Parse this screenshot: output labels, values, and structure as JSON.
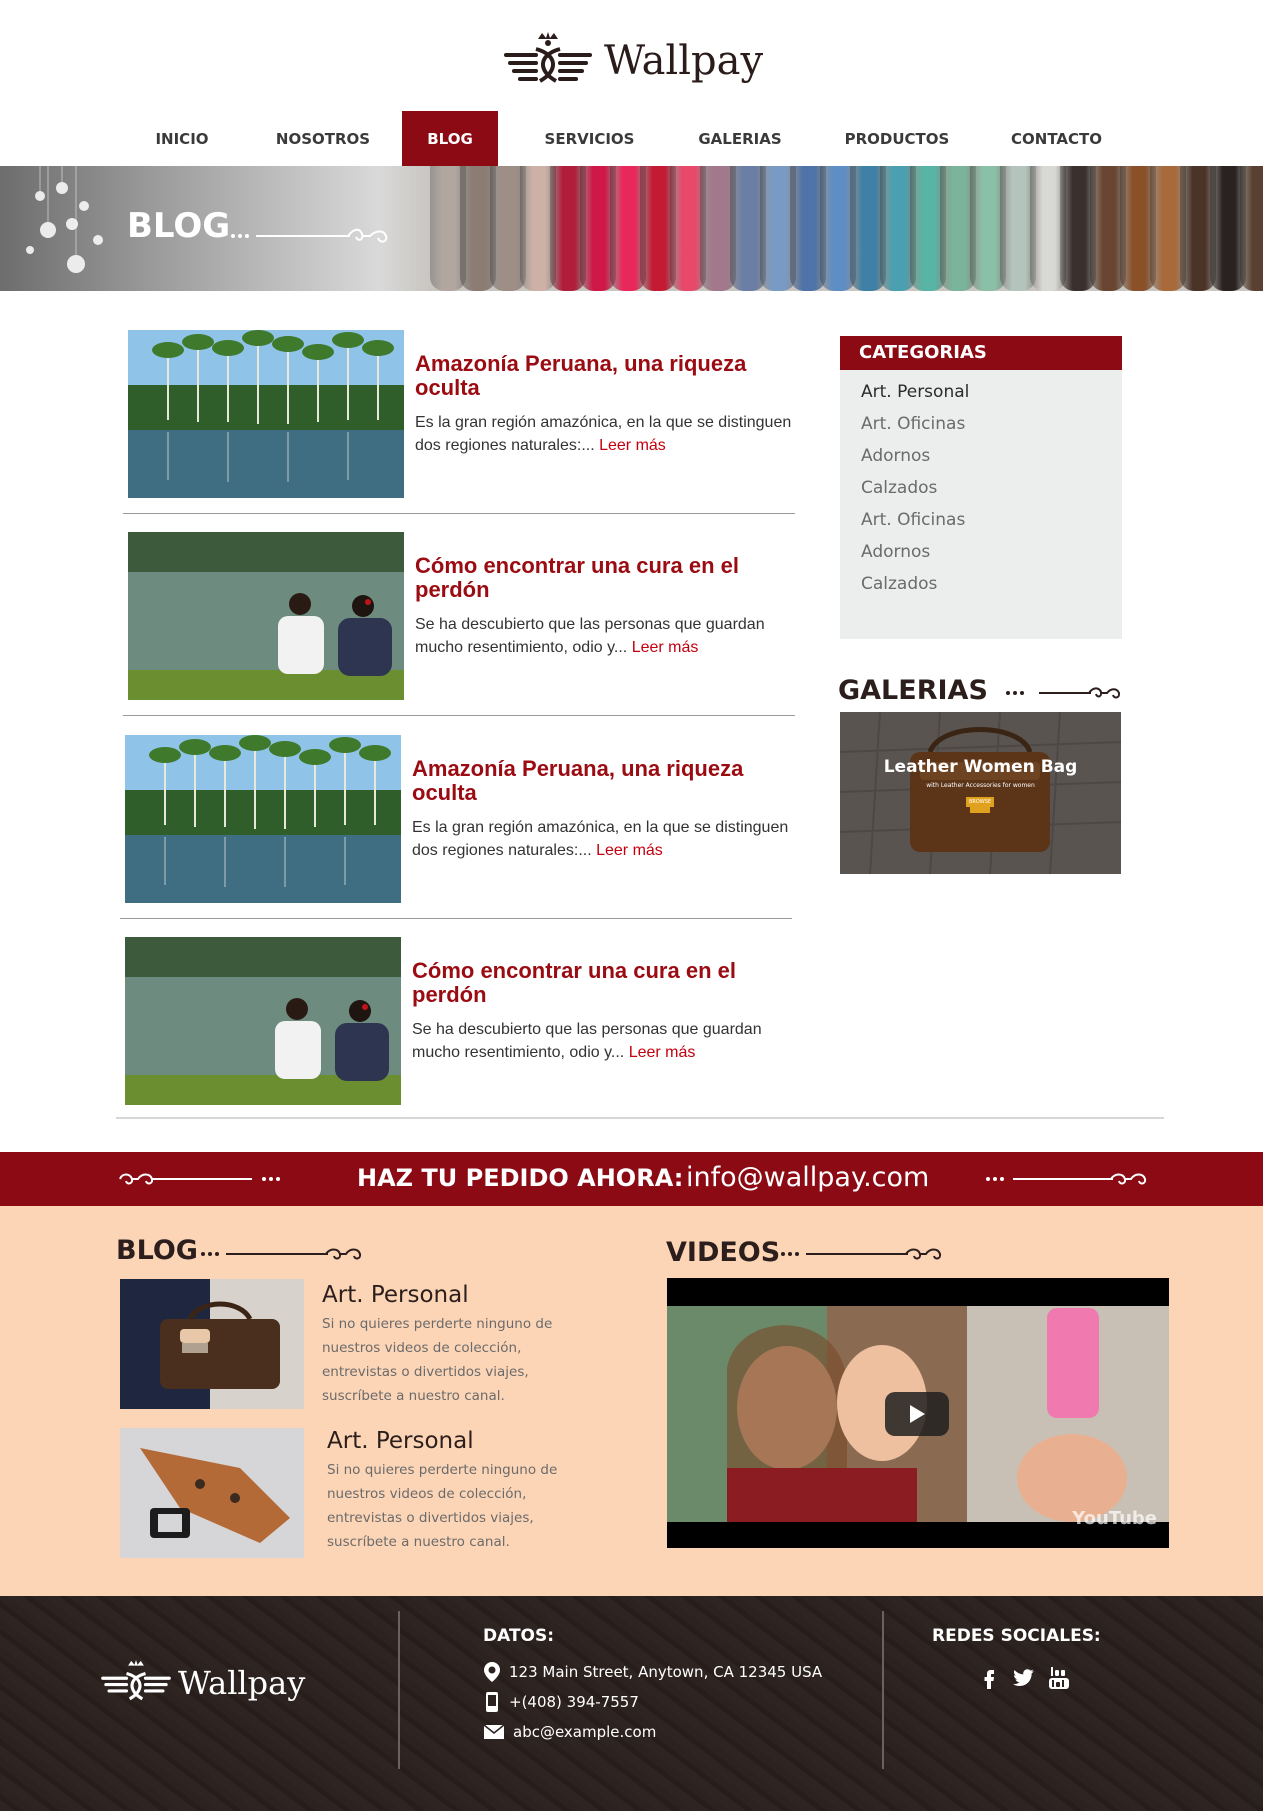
{
  "brand": {
    "name": "Wallpay",
    "accent": "#8c0a14",
    "peach": "#fcd5b7"
  },
  "nav": [
    {
      "label": "INICIO",
      "active": false
    },
    {
      "label": "NOSOTROS",
      "active": false
    },
    {
      "label": "BLOG",
      "active": true
    },
    {
      "label": "SERVICIOS",
      "active": false
    },
    {
      "label": "GALERIAS",
      "active": false
    },
    {
      "label": "PRODUCTOS",
      "active": false
    },
    {
      "label": "CONTACTO",
      "active": false
    }
  ],
  "banner": {
    "title": "BLOG"
  },
  "posts": [
    {
      "title": "Amazonía Peruana, una riqueza oculta",
      "excerpt": "Es la gran región amazónica, en la que se distinguen dos regiones naturales:... ",
      "read_more": "Leer más",
      "image": "rainforest-lake-photo"
    },
    {
      "title": "Cómo encontrar una cura en el perdón",
      "excerpt": "Se ha descubierto que las personas que guardan mucho resentimiento, odio y... ",
      "read_more": "Leer más",
      "image": "couple-by-lake-photo"
    },
    {
      "title": "Amazonía Peruana, una riqueza oculta",
      "excerpt": "Es la gran región amazónica, en la que se distinguen dos regiones naturales:... ",
      "read_more": "Leer más",
      "image": "rainforest-lake-photo"
    },
    {
      "title": "Cómo encontrar una cura en el perdón",
      "excerpt": "Se ha descubierto que las personas que guardan mucho resentimiento, odio y... ",
      "read_more": "Leer más",
      "image": "couple-by-lake-photo"
    }
  ],
  "categories": {
    "heading": "CATEGORIAS",
    "items": [
      "Art. Personal",
      "Art. Oficinas",
      "Adornos",
      "Calzados",
      "Art. Oficinas",
      "Adornos",
      "Calzados"
    ]
  },
  "galleries": {
    "heading": "GALERIAS",
    "image_title": "Leather Women Bag",
    "image_subtitle": "with Leather Accessories for women",
    "image_button": "BROWSE"
  },
  "order_bar": {
    "label": "HAZ TU PEDIDO AHORA:",
    "email": "info@wallpay.com"
  },
  "blog_section": {
    "heading": "BLOG",
    "items": [
      {
        "title": "Art. Personal",
        "text": "Si no quieres perderte ninguno de nuestros videos de colección, entrevistas o divertidos viajes, suscríbete a nuestro canal.",
        "image": "leather-briefcase-photo"
      },
      {
        "title": "Art. Personal",
        "text": "Si no quieres perderte ninguno de nuestros videos de colección, entrevistas o divertidos viajes, suscríbete a nuestro canal.",
        "image": "leather-strap-buckle-photo"
      }
    ]
  },
  "videos": {
    "heading": "VIDEOS",
    "player_logo": "YouTube"
  },
  "footer": {
    "logo": "Wallpay",
    "datos_heading": "DATOS:",
    "address": "123 Main Street, Anytown, CA 12345 USA",
    "phone": "+(408) 394-7557",
    "email": "abc@example.com",
    "social_heading": "REDES SOCIALES:",
    "social": [
      "facebook-icon",
      "twitter-icon",
      "youtube-icon"
    ]
  }
}
